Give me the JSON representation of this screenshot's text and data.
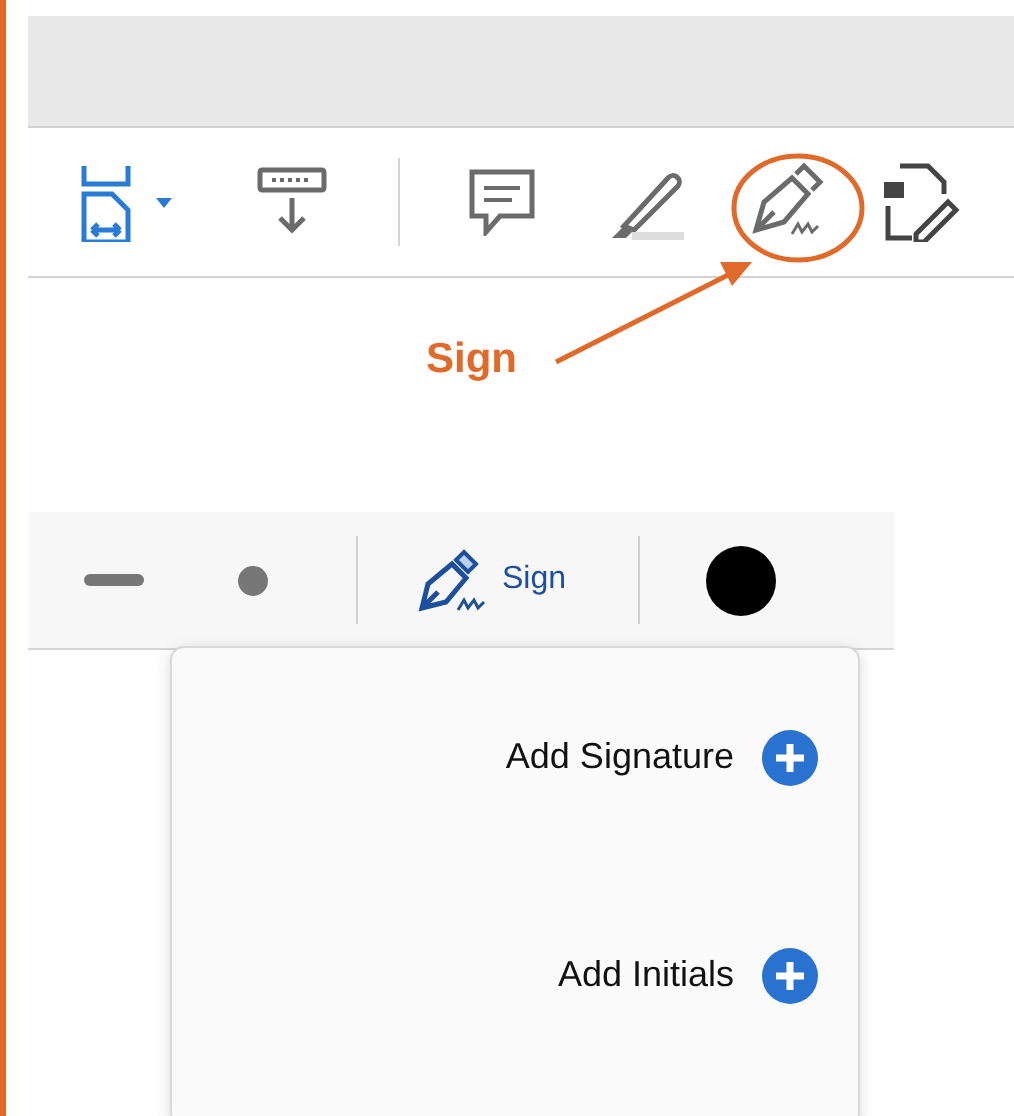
{
  "annotation": {
    "label": "Sign"
  },
  "sign_toolbar": {
    "sign_button": {
      "label": "Sign"
    }
  },
  "signature_menu": {
    "items": [
      {
        "label": "Add Signature"
      },
      {
        "label": "Add Initials"
      }
    ]
  }
}
